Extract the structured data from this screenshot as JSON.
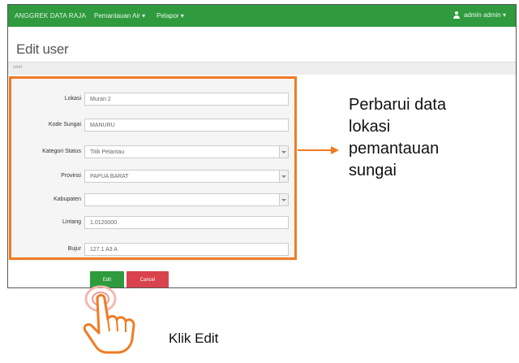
{
  "navbar": {
    "brand": "ANGGREK DATA RAJA",
    "items": [
      "Pemantauan Air ▾",
      "Pelapor ▾"
    ],
    "user": "admin admin ▾",
    "color": "#2f9a3e"
  },
  "page": {
    "title": "Edit user",
    "breadcrumb": "user"
  },
  "form": {
    "fields": [
      {
        "label": "Lokasi",
        "value": "Muran 2",
        "type": "text"
      },
      {
        "label": "Kode Sungai",
        "value": "MANURU",
        "type": "text"
      },
      {
        "label": "Kategori Status",
        "value": "Titik Pelantau",
        "type": "select"
      },
      {
        "label": "Provinsi",
        "value": "PAPUA BARAT",
        "type": "select"
      },
      {
        "label": "Kabupaten",
        "value": "",
        "type": "select"
      },
      {
        "label": "Lintang",
        "value": "1.0120000",
        "type": "text"
      },
      {
        "label": "Bujur",
        "value": "127.1 A3 A",
        "type": "text"
      }
    ],
    "edit_label": "Edit",
    "cancel_label": "Cancel"
  },
  "annotation": {
    "callout_lines": [
      "Perbarui data",
      "lokasi",
      "pemantauan",
      "sungai"
    ],
    "click_label": "Klik Edit",
    "accent_color": "#f07b22"
  }
}
